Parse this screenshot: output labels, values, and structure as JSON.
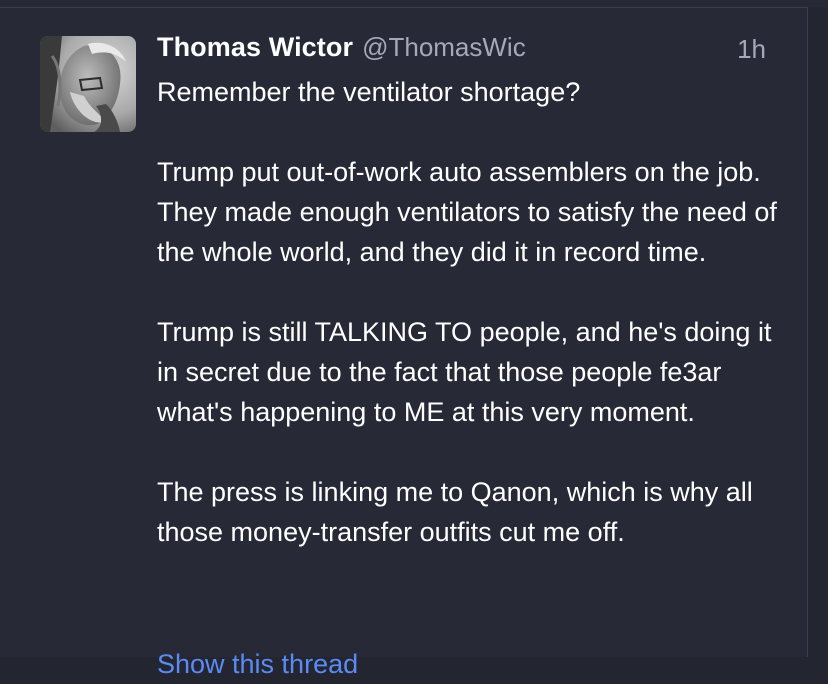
{
  "tweet": {
    "author": {
      "display_name": "Thomas Wictor",
      "handle": "@ThomasWic",
      "avatar": "author-avatar-photo"
    },
    "timestamp": "1h",
    "paragraphs": [
      "Remember the ventilator shortage?",
      "Trump put out-of-work auto assemblers on the job. They made enough ventilators to satisfy the need of the whole world, and they did it in record time.",
      "Trump is still TALKING TO people, and he's doing it in secret due to the fact that those people fe3ar what's happening to ME at this very moment.",
      "The press is linking me to Qanon, which is why all those money-transfer outfits cut me off."
    ],
    "show_thread_label": "Show this thread"
  },
  "colors": {
    "background": "#272a36",
    "text": "#ffffff",
    "muted": "#a4a8b8",
    "link": "#5b8bf2"
  }
}
